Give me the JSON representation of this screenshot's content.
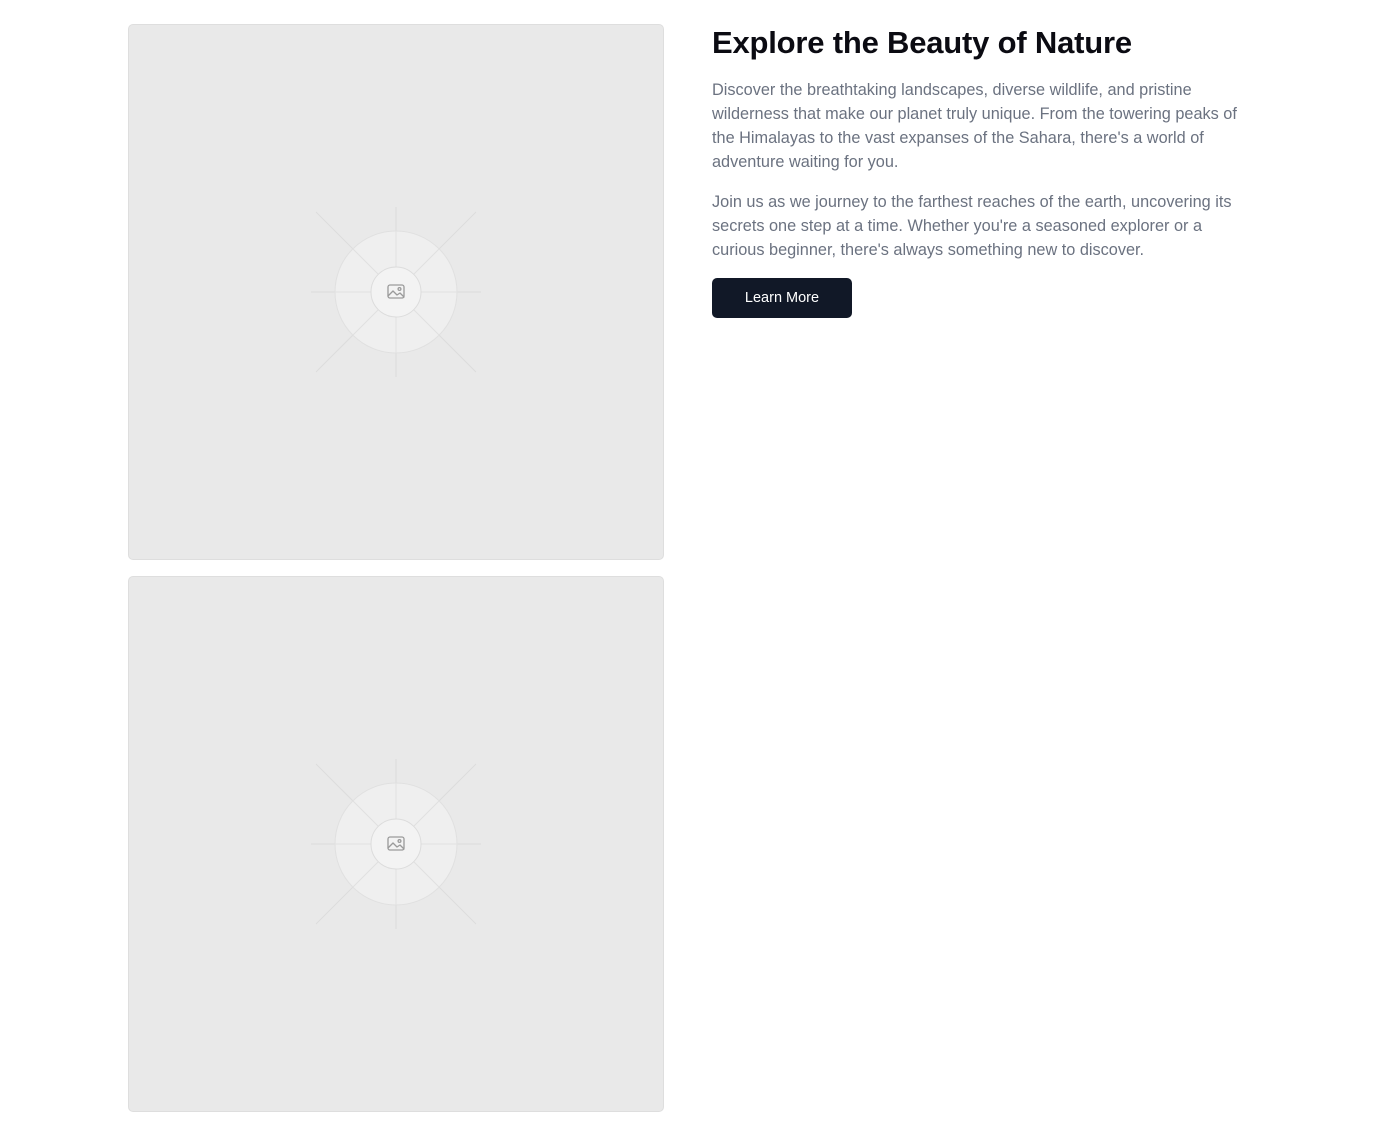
{
  "images": [
    {
      "icon": "image-placeholder-icon"
    },
    {
      "icon": "image-placeholder-icon"
    }
  ],
  "content": {
    "title": "Explore the Beauty of Nature",
    "paragraph_1": "Discover the breathtaking landscapes, diverse wildlife, and pristine wilderness that make our planet truly unique. From the towering peaks of the Himalayas to the vast expanses of the Sahara, there's a world of adventure waiting for you.",
    "paragraph_2": "Join us as we journey to the farthest reaches of the earth, uncovering its secrets one step at a time. Whether you're a seasoned explorer or a curious beginner, there's always something new to discover.",
    "button_label": "Learn More"
  },
  "colors": {
    "placeholder_bg": "#e9e9e9",
    "heading": "#0b0b12",
    "body_text": "#6b7280",
    "button_bg": "#111827",
    "button_text": "#ffffff"
  }
}
